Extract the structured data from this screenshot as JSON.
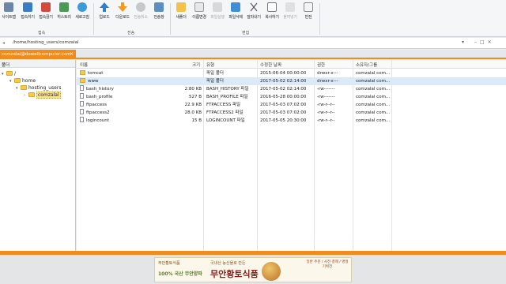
{
  "toolbar": {
    "buttons": [
      {
        "label": "사이트맵",
        "icon": "sitemap-icon",
        "disabled": false
      },
      {
        "label": "접속하기",
        "icon": "connect-icon",
        "disabled": false
      },
      {
        "label": "접속끊기",
        "icon": "disconnect-icon",
        "disabled": false
      },
      {
        "label": "히스토리",
        "icon": "history-icon",
        "disabled": false
      },
      {
        "label": "새로고침",
        "icon": "refresh-icon",
        "disabled": false
      },
      {
        "label": "업로드",
        "icon": "upload-icon",
        "disabled": false
      },
      {
        "label": "다운로드",
        "icon": "download-icon",
        "disabled": false
      },
      {
        "label": "전송취소",
        "icon": "cancel-transfer-icon",
        "disabled": true
      },
      {
        "label": "전송창",
        "icon": "transfer-window-icon",
        "disabled": false
      },
      {
        "label": "새폴더",
        "icon": "new-folder-icon",
        "disabled": false
      },
      {
        "label": "이름변경",
        "icon": "rename-icon",
        "disabled": false
      },
      {
        "label": "파일실행",
        "icon": "run-file-icon",
        "disabled": true
      },
      {
        "label": "파일삭제",
        "icon": "delete-file-icon",
        "disabled": false
      },
      {
        "label": "잘라내기",
        "icon": "cut-icon",
        "disabled": false
      },
      {
        "label": "복사하기",
        "icon": "copy-icon",
        "disabled": false
      },
      {
        "label": "붙여넣기",
        "icon": "paste-icon",
        "disabled": true
      },
      {
        "label": "반전",
        "icon": "invert-icon",
        "disabled": false
      }
    ],
    "groups": {
      "connect": "접속",
      "transfer": "전송",
      "edit": "편집"
    }
  },
  "address": {
    "path": "/home/hosting_users/comzalal"
  },
  "session_tab": {
    "label": "comzalal@dowellcomputer.com"
  },
  "tree": {
    "header": "폴더",
    "nodes": [
      {
        "label": "/",
        "level": 0
      },
      {
        "label": "home",
        "level": 1
      },
      {
        "label": "hosting_users",
        "level": 2
      },
      {
        "label": "comzalal",
        "level": 3
      }
    ]
  },
  "list": {
    "columns": [
      "이름",
      "크기",
      "유형",
      "수정한 날짜",
      "권한",
      "소유자/그룹"
    ],
    "rows": [
      {
        "name": "tomcat",
        "size": "",
        "type": "파일 폴더",
        "modified": "2015-06-04 00:00:00",
        "perm": "drwxr-x---",
        "owner": "comzalal com...",
        "kind": "folder"
      },
      {
        "name": "www",
        "size": "",
        "type": "파일 폴더",
        "modified": "2017-05-02 02:14:00",
        "perm": "drwxr-x---",
        "owner": "comzalal com...",
        "kind": "folder"
      },
      {
        "name": "bash_history",
        "size": "2.80 KB",
        "type": "BASH_HISTORY 파일",
        "modified": "2017-05-02 02:14:00",
        "perm": "-rw-------",
        "owner": "comzalal com...",
        "kind": "file"
      },
      {
        "name": "bash_profile",
        "size": "527 B",
        "type": "BASH_PROFILE 파일",
        "modified": "2016-05-28 00:00:00",
        "perm": "-rw-------",
        "owner": "comzalal com...",
        "kind": "file"
      },
      {
        "name": "ftpaccess",
        "size": "22.9 KB",
        "type": "FTPACCESS 파일",
        "modified": "2017-05-03 07:02:00",
        "perm": "-rw-r--r--",
        "owner": "comzalal com...",
        "kind": "file"
      },
      {
        "name": "ftpaccess2",
        "size": "28.0 KB",
        "type": "FTPACCESS2 파일",
        "modified": "2017-05-03 07:02:00",
        "perm": "-rw-r--r--",
        "owner": "comzalal com...",
        "kind": "file"
      },
      {
        "name": "logincount",
        "size": "15 B",
        "type": "LOGINCOUNT 파일",
        "modified": "2017-05-05 20:30:00",
        "perm": "-rw-r--r--",
        "owner": "comzalal com...",
        "kind": "file"
      }
    ]
  },
  "ad": {
    "brand": "무안황토식품",
    "slogan": "100% 국산 무안양파",
    "tagline": "국내산 농산물로 만든",
    "headline": "무안황토식품",
    "side": "일반 주문 / 사전 결제 / 명절 기획전"
  },
  "colors": {
    "accent": "#f08c1e",
    "selection": "#dbe9f8"
  }
}
